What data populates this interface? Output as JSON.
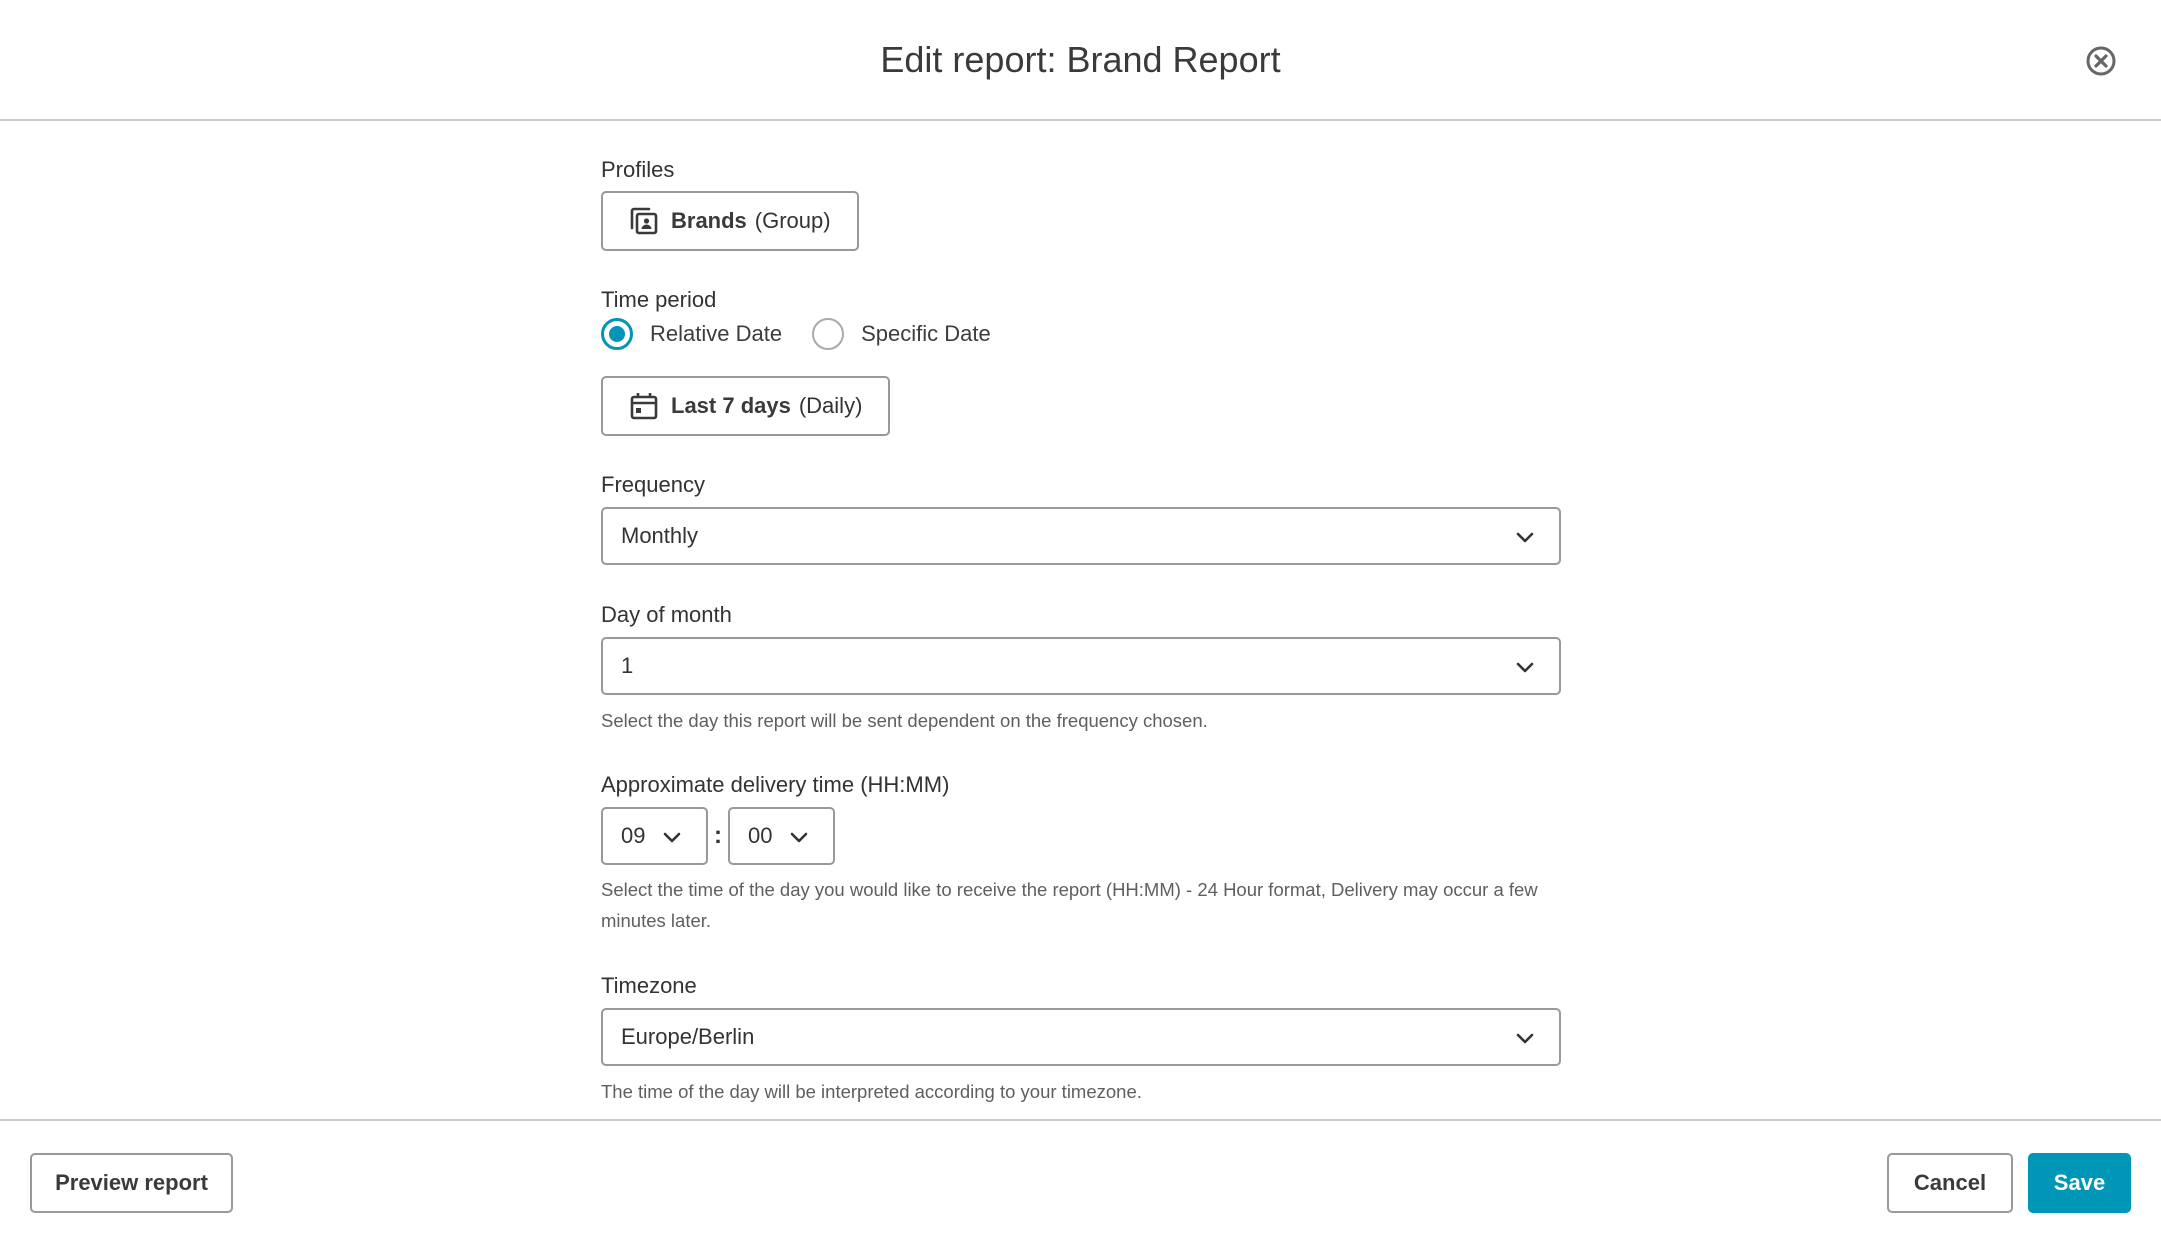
{
  "header": {
    "title": "Edit report: Brand Report",
    "close_icon": "close-circle-icon"
  },
  "profiles": {
    "label": "Profiles",
    "chip": {
      "icon": "profile-group-icon",
      "name": "Brands",
      "suffix": "(Group)"
    }
  },
  "time_period": {
    "label": "Time period",
    "options": [
      {
        "label": "Relative Date",
        "checked": true
      },
      {
        "label": "Specific Date",
        "checked": false
      }
    ],
    "chip": {
      "icon": "calendar-icon",
      "name": "Last 7 days",
      "suffix": "(Daily)"
    }
  },
  "frequency": {
    "label": "Frequency",
    "value": "Monthly"
  },
  "day_of_month": {
    "label": "Day of month",
    "value": "1",
    "help": "Select the day this report will be sent dependent on the frequency chosen."
  },
  "delivery_time": {
    "label": "Approximate delivery time (HH:MM)",
    "hour": "09",
    "separator": ":",
    "minute": "00",
    "help": "Select the time of the day you would like to receive the report (HH:MM) - 24 Hour format, Delivery may occur a few minutes later."
  },
  "timezone": {
    "label": "Timezone",
    "value": "Europe/Berlin",
    "help": "The time of the day will be interpreted according to your timezone."
  },
  "footer": {
    "preview_label": "Preview report",
    "cancel_label": "Cancel",
    "save_label": "Save"
  },
  "colors": {
    "accent": "#0096b8",
    "border": "#999999",
    "divider": "#cccccc",
    "text": "#333333",
    "help_text": "#5f5f5f"
  }
}
